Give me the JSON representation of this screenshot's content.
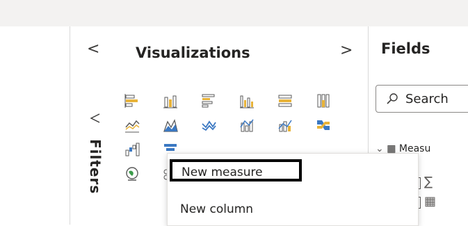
{
  "filters": {
    "label": "Filters",
    "collapse_glyph": "<"
  },
  "visualizations": {
    "title": "Visualizations",
    "expand_glyph": ">"
  },
  "fields": {
    "title": "Fields",
    "search_placeholder": "Search",
    "measure_row": "Measu"
  },
  "context_menu": {
    "items": [
      {
        "label": "New measure"
      },
      {
        "label": "New column"
      }
    ]
  },
  "colors": {
    "accent_gold": "#e8b339",
    "chart_gray": "#5a5a5a",
    "chart_blue": "#3b78c2",
    "highlight_border": "#000000"
  }
}
